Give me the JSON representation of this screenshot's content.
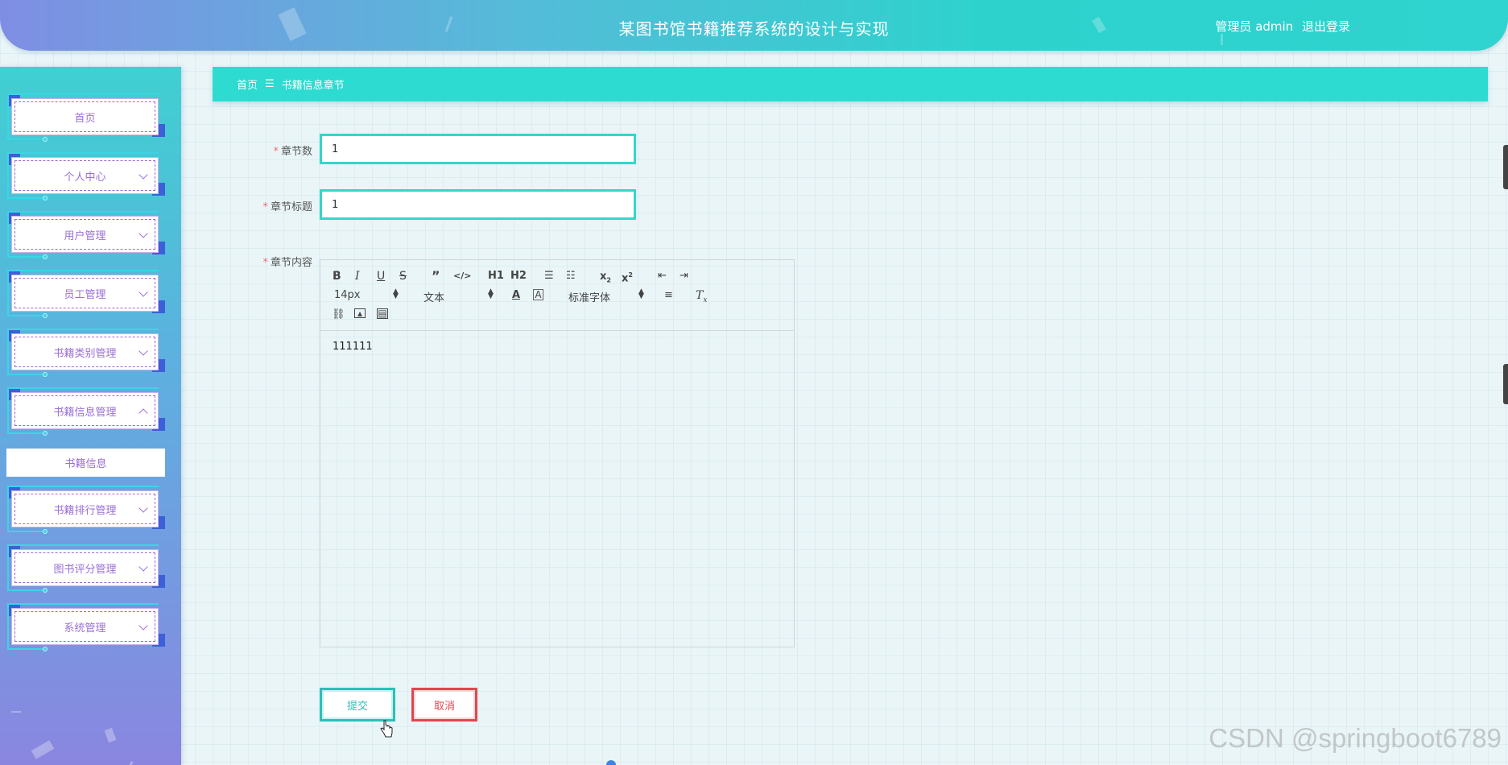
{
  "header": {
    "title": "某图书馆书籍推荐系统的设计与实现",
    "user_label": "管理员 admin",
    "logout_label": "退出登录"
  },
  "sidebar": {
    "items": [
      {
        "label": "首页",
        "has_chevron": false
      },
      {
        "label": "个人中心",
        "has_chevron": true
      },
      {
        "label": "用户管理",
        "has_chevron": true
      },
      {
        "label": "员工管理",
        "has_chevron": true
      },
      {
        "label": "书籍类别管理",
        "has_chevron": true
      },
      {
        "label": "书籍信息管理",
        "has_chevron": true,
        "expanded": true
      },
      {
        "label": "书籍排行管理",
        "has_chevron": true
      },
      {
        "label": "图书评分管理",
        "has_chevron": true
      },
      {
        "label": "系统管理",
        "has_chevron": true
      }
    ],
    "sub_item": "书籍信息"
  },
  "breadcrumb": {
    "home": "首页",
    "separator": "☰",
    "current": "书籍信息章节"
  },
  "form": {
    "chapter_number": {
      "label": "章节数",
      "value": "1"
    },
    "chapter_title": {
      "label": "章节标题",
      "value": "1"
    },
    "chapter_content": {
      "label": "章节内容",
      "value": "111111"
    },
    "required_mark": "*"
  },
  "editor_toolbar": {
    "h1": "H1",
    "h2": "H2",
    "font_size": "14px",
    "header_type": "文本",
    "font_family": "标准字体"
  },
  "buttons": {
    "submit": "提交",
    "cancel": "取消"
  },
  "watermark": "CSDN @springboot6789",
  "colors": {
    "accent": "#2edbd0",
    "menu_text": "#9a6fd6",
    "required": "#f56c6c",
    "cancel": "#e0474f"
  }
}
